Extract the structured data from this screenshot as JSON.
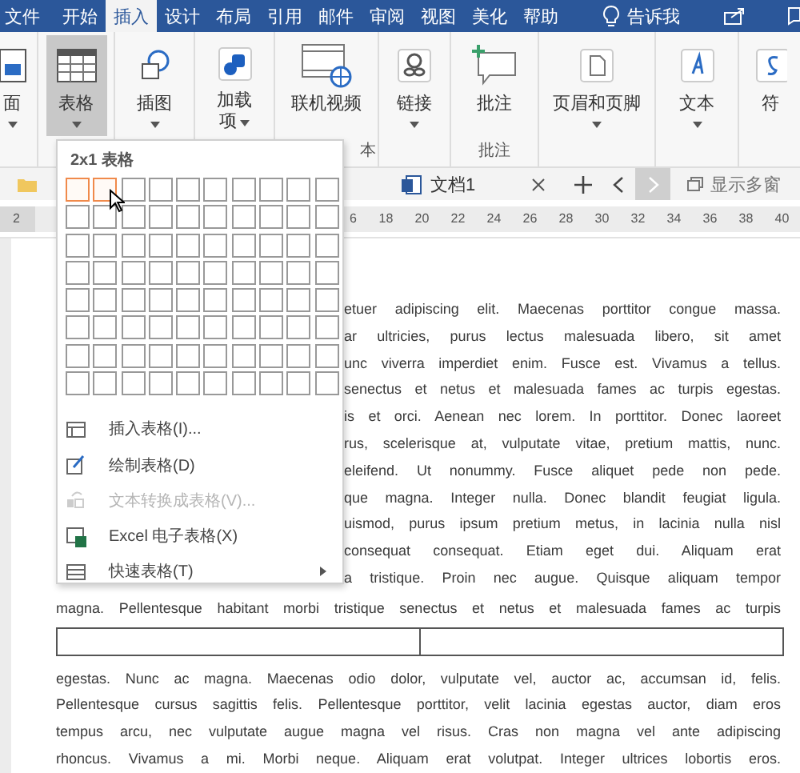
{
  "ribbon_tabs": [
    {
      "label": "文件",
      "selected": false
    },
    {
      "label": "开始",
      "selected": false
    },
    {
      "label": "插入",
      "selected": true
    },
    {
      "label": "设计",
      "selected": false
    },
    {
      "label": "布局",
      "selected": false
    },
    {
      "label": "引用",
      "selected": false
    },
    {
      "label": "邮件",
      "selected": false
    },
    {
      "label": "审阅",
      "selected": false
    },
    {
      "label": "视图",
      "selected": false
    },
    {
      "label": "美化",
      "selected": false
    },
    {
      "label": "帮助",
      "selected": false
    }
  ],
  "tell_me": "告诉我",
  "ribbon_groups": [
    {
      "buttons": [
        {
          "label": "面",
          "kind": "page",
          "pressed": false,
          "dropdown": true
        }
      ]
    },
    {
      "buttons": [
        {
          "label": "表格",
          "kind": "table",
          "pressed": true,
          "dropdown": true
        }
      ]
    },
    {
      "buttons": [
        {
          "label": "插图",
          "kind": "shapes",
          "pressed": false,
          "dropdown": true
        }
      ]
    },
    {
      "buttons": [
        {
          "label": "加载项",
          "kind": "addin",
          "pressed": false,
          "dropdown": true,
          "caret_inline": true
        }
      ]
    },
    {
      "label": "本",
      "buttons": [
        {
          "label": "联机视频",
          "kind": "video",
          "pressed": false,
          "dropdown": false
        }
      ]
    },
    {
      "buttons": [
        {
          "label": "链接",
          "kind": "link",
          "pressed": false,
          "dropdown": true
        }
      ]
    },
    {
      "label": "批注",
      "buttons": [
        {
          "label": "批注",
          "kind": "comment",
          "pressed": false,
          "dropdown": false
        }
      ]
    },
    {
      "buttons": [
        {
          "label": "页眉和页脚",
          "kind": "header",
          "pressed": false,
          "dropdown": true
        }
      ]
    },
    {
      "buttons": [
        {
          "label": "文本",
          "kind": "text",
          "pressed": false,
          "dropdown": true
        }
      ]
    },
    {
      "buttons": [
        {
          "label": "符",
          "kind": "symbol",
          "pressed": false,
          "dropdown": false
        }
      ]
    }
  ],
  "doc_tab": {
    "title": "文档1"
  },
  "show_windows": "显示多窗",
  "ruler": [
    "2",
    "6",
    "18",
    "20",
    "22",
    "24",
    "26",
    "28",
    "30",
    "32",
    "34",
    "36",
    "38",
    "40"
  ],
  "document": {
    "covered_lines": [
      "etuer adipiscing elit. Maecenas porttitor congue massa.",
      "ar ultricies, purus lectus malesuada libero, sit amet",
      "unc viverra imperdiet enim. Fusce est. Vivamus a tellus.",
      "senectus et netus et malesuada fames ac turpis egestas.",
      "is et orci. Aenean nec lorem. In porttitor. Donec laoreet",
      "rus, scelerisque at, vulputate vitae, pretium mattis, nunc.",
      "eleifend. Ut nonummy. Fusce aliquet pede non pede.",
      "que magna. Integer nulla. Donec blandit feugiat ligula.",
      "uismod, purus ipsum pretium metus, in lacinia nulla nisl",
      "consequat consequat. Etiam eget dui. Aliquam erat",
      "a tristique. Proin nec augue. Quisque aliquam tempor"
    ],
    "lines_before_table": [
      "magna. Pellentesque habitant morbi tristique senectus et netus et malesuada fames ac turpis"
    ],
    "table": {
      "rows": [
        {
          "cells": [
            {},
            {}
          ]
        }
      ]
    },
    "lines_after_table": [
      "egestas. Nunc ac magna. Maecenas odio dolor, vulputate vel, auctor ac, accumsan id, felis.",
      "Pellentesque cursus sagittis felis. Pellentesque porttitor, velit lacinia egestas auctor, diam eros",
      "tempus arcu, nec vulputate augue magna vel risus. Cras non magna vel ante adipiscing",
      "rhoncus. Vivamus a mi. Morbi neque. Aliquam erat volutpat. Integer ultrices lobortis eros."
    ]
  },
  "table_menu": {
    "header": "2x1 表格",
    "highlighted_cells": [
      [
        true,
        true,
        false,
        false,
        false,
        false,
        false,
        false,
        false,
        false
      ],
      [
        false,
        false,
        false,
        false,
        false,
        false,
        false,
        false,
        false,
        false
      ],
      [
        false,
        false,
        false,
        false,
        false,
        false,
        false,
        false,
        false,
        false
      ],
      [
        false,
        false,
        false,
        false,
        false,
        false,
        false,
        false,
        false,
        false
      ],
      [
        false,
        false,
        false,
        false,
        false,
        false,
        false,
        false,
        false,
        false
      ],
      [
        false,
        false,
        false,
        false,
        false,
        false,
        false,
        false,
        false,
        false
      ],
      [
        false,
        false,
        false,
        false,
        false,
        false,
        false,
        false,
        false,
        false
      ],
      [
        false,
        false,
        false,
        false,
        false,
        false,
        false,
        false,
        false,
        false
      ]
    ],
    "items": [
      {
        "label": "插入表格(I)...",
        "kind": "insert",
        "disabled": false,
        "submenu": false
      },
      {
        "label": "绘制表格(D)",
        "kind": "draw",
        "disabled": false,
        "submenu": false
      },
      {
        "label": "文本转换成表格(V)...",
        "kind": "convert",
        "disabled": true,
        "submenu": false
      },
      {
        "label": "Excel 电子表格(X)",
        "kind": "excel",
        "disabled": false,
        "submenu": false
      },
      {
        "label": "快速表格(T)",
        "kind": "quick",
        "disabled": false,
        "submenu": true
      }
    ]
  }
}
